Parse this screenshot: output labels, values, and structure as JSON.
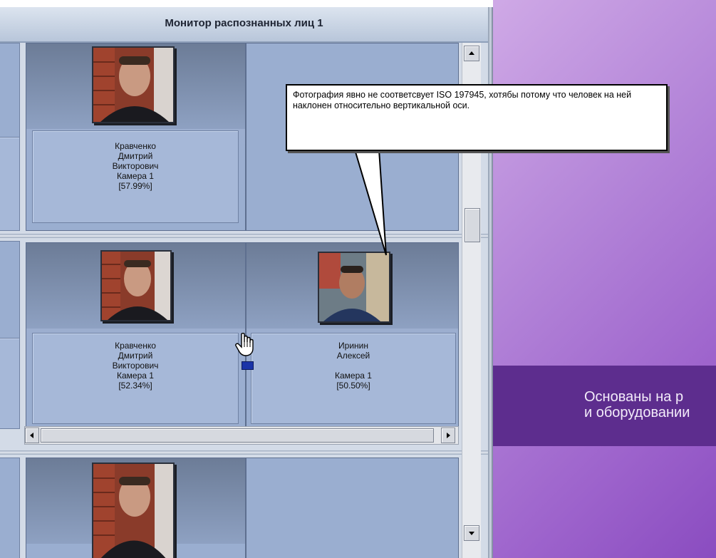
{
  "window": {
    "title": "Монитор распознанных лиц 1"
  },
  "cards": [
    {
      "name": "Кравченко",
      "middle": "Дмитрий",
      "patronymic": "Викторович",
      "camera": "Камера 1",
      "score": "[57.99%]"
    },
    {
      "name": "Кравченко",
      "middle": "Дмитрий",
      "patronymic": "Викторович",
      "camera": "Камера 1",
      "score": "[52.34%]"
    },
    {
      "name": "Иринин",
      "middle": "Алексей",
      "patronymic": "",
      "camera": "Камера 1",
      "score": "[50.50%]"
    }
  ],
  "callout": {
    "text": "Фотография явно не соответсвует ISO 197945, хотябы потому что человек на ней наклонен относительно вертикальной оси."
  },
  "banner": {
    "line1": "Основаны на р",
    "line2": "и оборудовании"
  },
  "scroll": {
    "position": 0.35
  },
  "colors": {
    "panel": "#9aaed0",
    "purple": "#5d2d8e"
  }
}
